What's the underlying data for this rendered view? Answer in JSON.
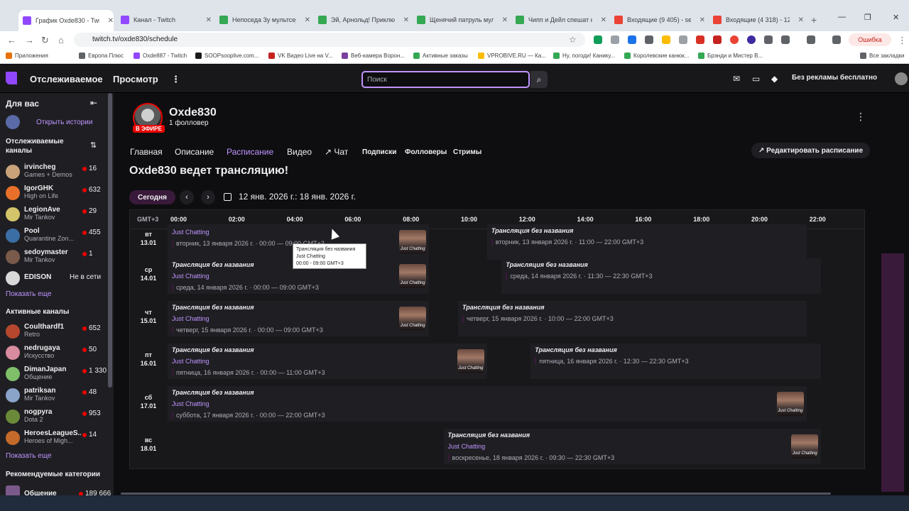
{
  "browser": {
    "tabs": [
      {
        "title": "График Oxde830 - Twitch",
        "icon": "twitch-icon",
        "color": "#9147ff",
        "active": true
      },
      {
        "title": "Канал - Twitch",
        "icon": "twitch-icon",
        "color": "#9147ff"
      },
      {
        "title": "Непоседа Зу мультсериал",
        "icon": "check-icon",
        "color": "#34a853"
      },
      {
        "title": "Эй, Арнольд! Приключения",
        "icon": "check-icon",
        "color": "#34a853"
      },
      {
        "title": "Щенячий патруль мульт",
        "icon": "check-icon",
        "color": "#34a853"
      },
      {
        "title": "Чипп и Дейл спешат на по",
        "icon": "check-icon",
        "color": "#34a853"
      },
      {
        "title": "Входящие (9 405) - serge",
        "icon": "gmail-icon",
        "color": "#ea4335"
      },
      {
        "title": "Входящие (4 318) - 12dir",
        "icon": "gmail-icon",
        "color": "#ea4335"
      }
    ],
    "url": "twitch.tv/oxde830/schedule",
    "error_label": "Ошибка",
    "bookmarks": [
      "Приложения",
      "Европа Плюс",
      "Oxde887 - Twitch",
      "SOOPsooplive.com...",
      "VK Видео Live на V...",
      "Веб-камера Ворон...",
      "Активные заказы",
      "VPROBIVE.RU — Ка...",
      "Ну, погоди! Канику...",
      "Королевские канюк...",
      "Брэнди и Мистер В..."
    ],
    "all_bookmarks": "Все закладки"
  },
  "topnav": {
    "following": "Отслеживаемое",
    "browse": "Просмотр",
    "search_placeholder": "Поиск",
    "no_ads": "Без рекламы бесплатно"
  },
  "sidebar": {
    "for_you": "Для вас",
    "open_stories": "Открыть истории",
    "followed_channels": "Отслеживаемые каналы",
    "followed": [
      {
        "name": "irvincheg",
        "category": "Games + Demos",
        "viewers": "16",
        "color": "#c9a27a"
      },
      {
        "name": "IgorGHK",
        "category": "High on Life",
        "viewers": "632",
        "color": "#e8702a"
      },
      {
        "name": "LegionAve",
        "category": "Mir Tankov",
        "viewers": "29",
        "color": "#d4c46a"
      },
      {
        "name": "Pool",
        "category": "Quarantine Zon...",
        "viewers": "455",
        "color": "#3b6ea5"
      },
      {
        "name": "sedoymaster",
        "category": "Mir Tankov",
        "viewers": "1",
        "color": "#7a5a4a"
      },
      {
        "name": "EDISON",
        "category": "",
        "viewers": "Не в сети",
        "color": "#d9d9d9"
      }
    ],
    "show_more_1": "Показать еще",
    "active_channels": "Активные каналы",
    "active": [
      {
        "name": "Coulthardf1",
        "category": "Retro",
        "viewers": "652",
        "color": "#b5472e"
      },
      {
        "name": "nedrugaya",
        "category": "Искусство",
        "viewers": "50",
        "color": "#d98ba0"
      },
      {
        "name": "DimanJapan",
        "category": "Общение",
        "viewers": "1 330",
        "color": "#7fbf6a"
      },
      {
        "name": "patriksan",
        "category": "Mir Tankov",
        "viewers": "48",
        "color": "#8aa3c9"
      },
      {
        "name": "nogpyra",
        "category": "Dota 2",
        "viewers": "953",
        "color": "#6a8a3a"
      },
      {
        "name": "HeroesLeagueS...",
        "category": "Heroes of Migh...",
        "viewers": "14",
        "color": "#c46a2a"
      }
    ],
    "show_more_2": "Показать еще",
    "recommended_categories": "Рекомендуемые категории",
    "recommended": [
      {
        "name": "Общение",
        "viewers": "189 666"
      }
    ]
  },
  "channel": {
    "name": "Oxde830",
    "followers": "1 фолловер",
    "live_badge": "В ЭФИРЕ",
    "tabs": [
      "Главная",
      "Описание",
      "Расписание",
      "Видео",
      "Чат",
      "Подписки",
      "Фолловеры",
      "Стримы"
    ],
    "edit_schedule": "Редактировать расписание",
    "heading": "Oxde830 ведет трансляцию!"
  },
  "schedule": {
    "today": "Сегодня",
    "range": "12 янв. 2026 г.: 18 янв. 2026 г.",
    "timezone": "GMT+3",
    "ticks": [
      "00:00",
      "02:00",
      "04:00",
      "06:00",
      "08:00",
      "10:00",
      "12:00",
      "14:00",
      "16:00",
      "18:00",
      "20:00",
      "22:00"
    ],
    "days": [
      {
        "dow": "вт",
        "date": "13.01",
        "segments": [
          {
            "title": "",
            "category": "Just Chatting",
            "time": "вторник, 13 января 2026 г. · 00:00 — 09:00 GMT+3",
            "start": 0,
            "end": 9
          },
          {
            "title": "Трансляция без названия",
            "category": "",
            "time": "вторник, 13 января 2026 г. · 11:00 — 22:00 GMT+3",
            "start": 11,
            "end": 22
          }
        ]
      },
      {
        "dow": "ср",
        "date": "14.01",
        "segments": [
          {
            "title": "Трансляция без названия",
            "category": "Just Chatting",
            "time": "среда, 14 января 2026 г. · 00:00 — 09:00 GMT+3",
            "start": 0,
            "end": 9
          },
          {
            "title": "Трансляция без названия",
            "category": "",
            "time": "среда, 14 января 2026 г. · 11:30 — 22:30 GMT+3",
            "start": 11.5,
            "end": 22.5
          }
        ]
      },
      {
        "dow": "чт",
        "date": "15.01",
        "segments": [
          {
            "title": "Трансляция без названия",
            "category": "Just Chatting",
            "time": "четверг, 15 января 2026 г. · 00:00 — 09:00 GMT+3",
            "start": 0,
            "end": 9
          },
          {
            "title": "Трансляция без названия",
            "category": "",
            "time": "четверг, 15 января 2026 г. · 10:00 — 22:00 GMT+3",
            "start": 10,
            "end": 22
          }
        ]
      },
      {
        "dow": "пт",
        "date": "16.01",
        "segments": [
          {
            "title": "Трансляция без названия",
            "category": "Just Chatting",
            "time": "пятница, 16 января 2026 г. · 00:00 — 11:00 GMT+3",
            "start": 0,
            "end": 11
          },
          {
            "title": "Трансляция без названия",
            "category": "",
            "time": "пятница, 16 января 2026 г. · 12:30 — 22:30 GMT+3",
            "start": 12.5,
            "end": 22.5
          }
        ]
      },
      {
        "dow": "сб",
        "date": "17.01",
        "segments": [
          {
            "title": "Трансляция без названия",
            "category": "Just Chatting",
            "time": "суббота, 17 января 2026 г. · 00:00 — 22:00 GMT+3",
            "start": 0,
            "end": 22
          }
        ]
      },
      {
        "dow": "вс",
        "date": "18.01",
        "segments": [
          {
            "title": "Трансляция без названия",
            "category": "Just Chatting",
            "time": "воскресенье, 18 января 2026 г. · 09:30 — 22:30 GMT+3",
            "start": 9.5,
            "end": 22.5
          }
        ]
      }
    ],
    "thumb_label": "Just Chatting",
    "tooltip": [
      "Трансляция без названия",
      "Just Chatting",
      "00:00 - 09:00 GMT+3"
    ]
  }
}
